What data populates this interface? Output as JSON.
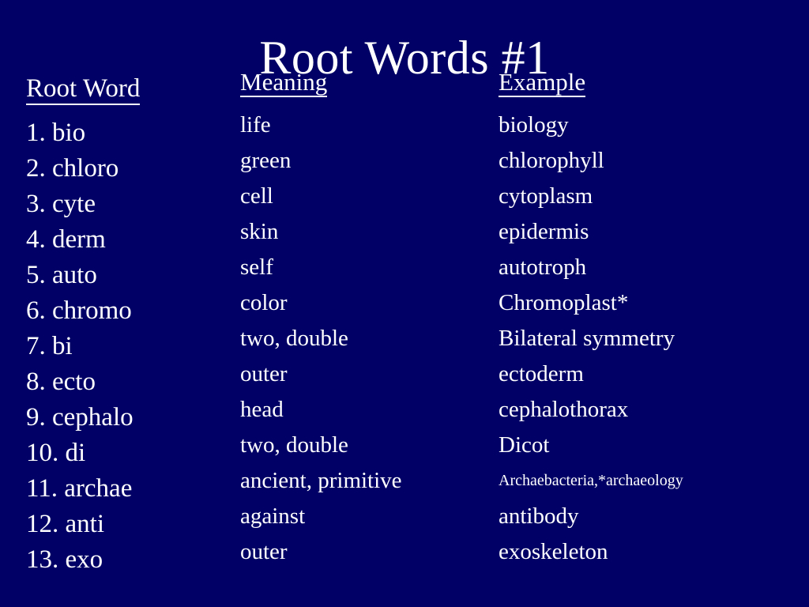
{
  "slide": {
    "title": "Root Words #1",
    "background_color": "#000066",
    "text_color": "#ffffff"
  },
  "columns": [
    {
      "key": "root_word",
      "header": "Root Word",
      "cells": [
        "1. bio",
        "2. chloro",
        "3. cyte",
        "4. derm",
        "5. auto",
        "6. chromo",
        "7. bi",
        "8. ecto",
        "9. cephalo",
        "10. di",
        "11. archae",
        "12. anti",
        "13. exo"
      ]
    },
    {
      "key": "meaning",
      "header": "Meaning",
      "cells": [
        "life",
        "green",
        "cell",
        "skin",
        "self",
        "color",
        "two, double",
        "outer",
        "head",
        "two, double",
        "ancient, primitive",
        "against",
        "outer"
      ]
    },
    {
      "key": "example",
      "header": "Example",
      "cells": [
        "biology",
        "chlorophyll",
        "cytoplasm",
        "epidermis",
        "autotroph",
        "Chromoplast*",
        "Bilateral symmetry",
        "ectoderm",
        "cephalothorax",
        "Dicot",
        "Archaebacteria,*archaeology",
        "antibody",
        "exoskeleton"
      ],
      "small_cells": [
        10
      ]
    }
  ]
}
